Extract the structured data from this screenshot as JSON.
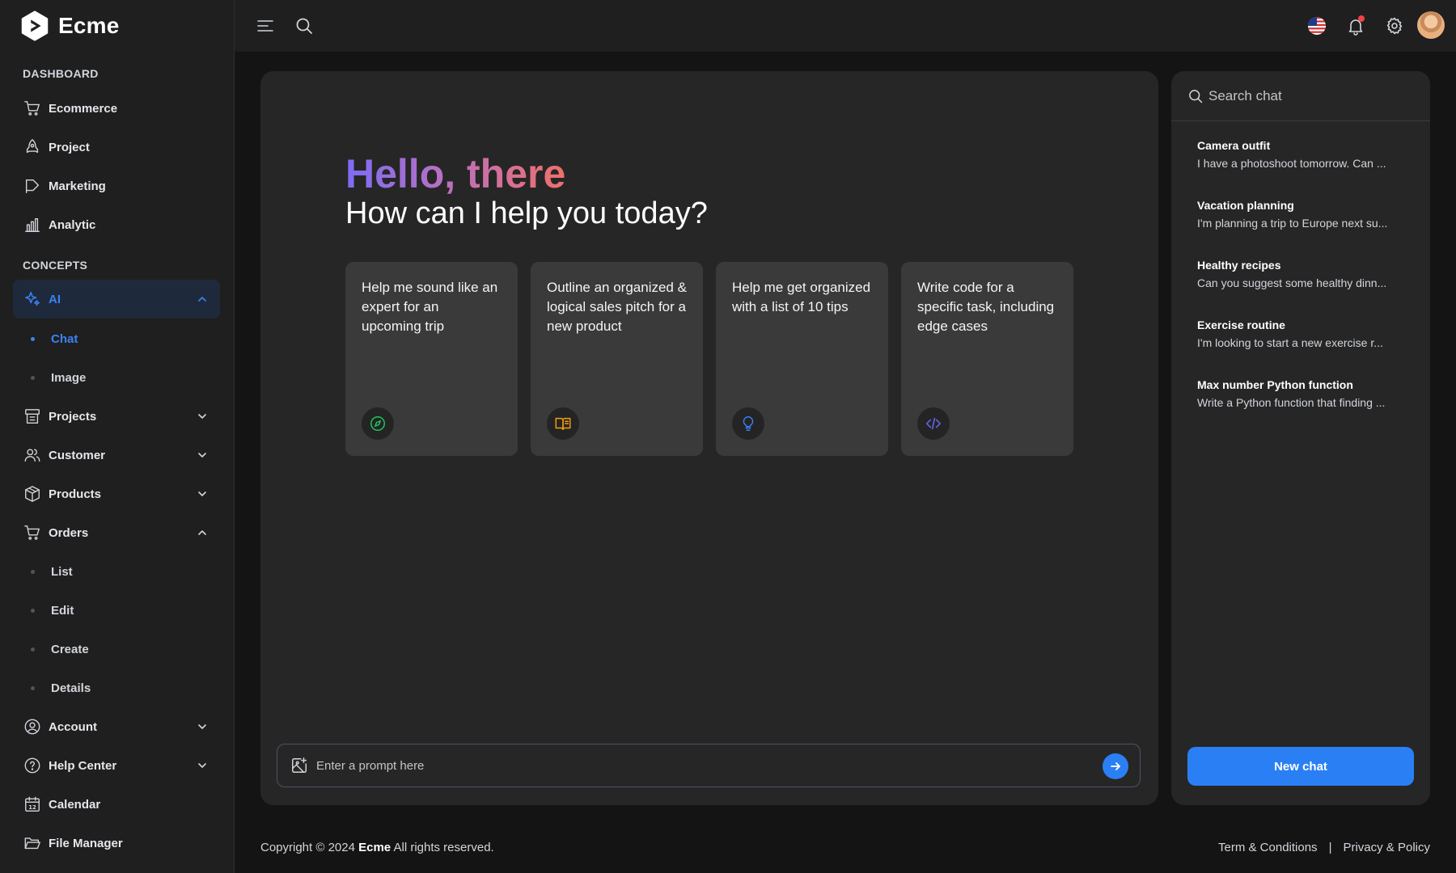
{
  "app": {
    "name": "Ecme"
  },
  "sidebar": {
    "sections": [
      {
        "title": "DASHBOARD"
      },
      {
        "title": "CONCEPTS"
      }
    ],
    "dashboard_items": [
      {
        "label": "Ecommerce",
        "icon": "cart-icon"
      },
      {
        "label": "Project",
        "icon": "rocket-icon"
      },
      {
        "label": "Marketing",
        "icon": "flag-icon"
      },
      {
        "label": "Analytic",
        "icon": "bar-chart-icon"
      }
    ],
    "ai": {
      "label": "AI",
      "icon": "sparkle-icon",
      "expanded": true,
      "children": [
        {
          "label": "Chat",
          "active": true
        },
        {
          "label": "Image",
          "active": false
        }
      ]
    },
    "concept_items": [
      {
        "label": "Projects",
        "icon": "projects-icon"
      },
      {
        "label": "Customer",
        "icon": "users-icon"
      },
      {
        "label": "Products",
        "icon": "box-icon"
      }
    ],
    "orders": {
      "label": "Orders",
      "icon": "cart-icon",
      "expanded": true,
      "children": [
        {
          "label": "List"
        },
        {
          "label": "Edit"
        },
        {
          "label": "Create"
        },
        {
          "label": "Details"
        }
      ]
    },
    "bottom_items": [
      {
        "label": "Account",
        "icon": "user-circle-icon"
      },
      {
        "label": "Help Center",
        "icon": "help-icon"
      },
      {
        "label": "Calendar",
        "icon": "calendar-icon",
        "calendar_day": "12"
      },
      {
        "label": "File Manager",
        "icon": "folder-icon"
      }
    ]
  },
  "header": {
    "icons": [
      "menu-icon",
      "search-icon",
      "us-flag-icon",
      "bell-icon",
      "gear-icon",
      "avatar"
    ],
    "has_notification": true
  },
  "main": {
    "greeting": "Hello, there",
    "subtitle": "How can I help you today?",
    "suggestions": [
      {
        "text": "Help me sound like an expert for an upcoming trip",
        "icon": "compass-icon",
        "color": "#22c55e"
      },
      {
        "text": "Outline an organized & logical sales pitch for a new product",
        "icon": "book-icon",
        "color": "#f59e0b"
      },
      {
        "text": "Help me get organized with a list of 10 tips",
        "icon": "lightbulb-icon",
        "color": "#3b82f6"
      },
      {
        "text": "Write code for a specific task, including edge cases",
        "icon": "code-icon",
        "color": "#6366f1"
      }
    ],
    "prompt": {
      "placeholder": "Enter a prompt here",
      "value": ""
    }
  },
  "chat_panel": {
    "search_placeholder": "Search chat",
    "chats": [
      {
        "title": "Camera outfit",
        "preview": "I have a photoshoot tomorrow. Can ..."
      },
      {
        "title": "Vacation planning",
        "preview": "I'm planning a trip to Europe next su..."
      },
      {
        "title": "Healthy recipes",
        "preview": "Can you suggest some healthy dinn..."
      },
      {
        "title": "Exercise routine",
        "preview": "I'm looking to start a new exercise r..."
      },
      {
        "title": "Max number Python function",
        "preview": "Write a Python function that finding ..."
      }
    ],
    "new_chat_label": "New chat"
  },
  "footer": {
    "copyright_prefix": "Copyright © 2024",
    "brand": "Ecme",
    "copyright_suffix": "All rights reserved.",
    "links": [
      "Term & Conditions",
      "Privacy & Policy"
    ],
    "separator": "|"
  },
  "colors": {
    "accent": "#2a7ff5",
    "sidebar_bg": "#1f1f1f",
    "panel_bg": "#262626",
    "card_bg": "#3a3a3a",
    "active_nav_bg": "#1e2a3b"
  }
}
